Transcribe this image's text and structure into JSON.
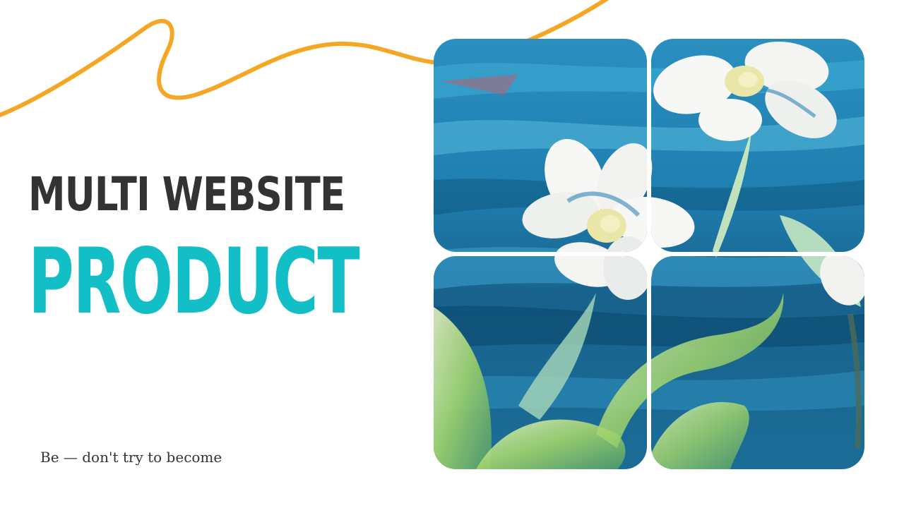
{
  "headline": {
    "line1": "MULTI WEBSITE",
    "line2": "PRODUCT"
  },
  "tagline": "Be — don't try to become",
  "colors": {
    "headline_dark": "#333333",
    "headline_accent": "#12bfc6",
    "squiggle": "#f5a623",
    "painting_blue": "#1e78a6"
  },
  "gallery": {
    "subject": "abstract impasto painting of white flowers on blue background",
    "tiles": 4
  }
}
